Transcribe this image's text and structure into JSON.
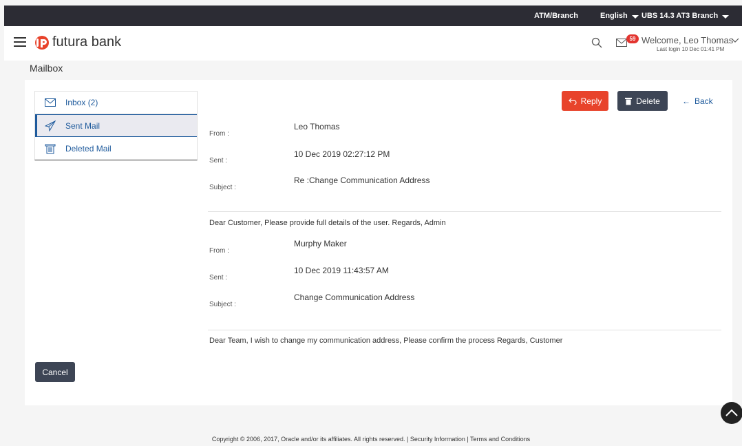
{
  "topbar": {
    "atm_branch": "ATM/Branch",
    "language": "English",
    "branch": "UBS 14.3 AT3 Branch"
  },
  "header": {
    "logo_text": "futura bank",
    "notification_count": "59",
    "welcome": "Welcome, Leo Thomas",
    "last_login": "Last login 10 Dec 01:41 PM"
  },
  "page": {
    "title": "Mailbox"
  },
  "sidebar": {
    "items": [
      {
        "label": "Inbox (2)",
        "icon": "envelope-icon"
      },
      {
        "label": "Sent Mail",
        "icon": "paper-plane-icon"
      },
      {
        "label": "Deleted Mail",
        "icon": "trash-icon"
      }
    ]
  },
  "actions": {
    "reply": "Reply",
    "delete": "Delete",
    "back": "Back",
    "cancel": "Cancel"
  },
  "labels": {
    "from": "From :",
    "sent": "Sent :",
    "subject": "Subject :"
  },
  "messages": [
    {
      "from": "Leo Thomas",
      "sent": "10 Dec 2019 02:27:12 PM",
      "subject": "Re :Change Communication Address",
      "body": "Dear Customer, Please provide full details of the user. Regards, Admin"
    },
    {
      "from": "Murphy Maker",
      "sent": "10 Dec 2019 11:43:57 AM",
      "subject": "Change Communication Address",
      "body": "Dear Team, I wish to change my communication address, Please confirm the process Regards, Customer"
    }
  ],
  "footer": {
    "text": "Copyright © 2006, 2017, Oracle and/or its affiliates. All rights reserved. | Security Information | Terms and Conditions"
  },
  "colors": {
    "accent": "#e8432b",
    "dark": "#3d4555",
    "link": "#1e5a9c"
  }
}
